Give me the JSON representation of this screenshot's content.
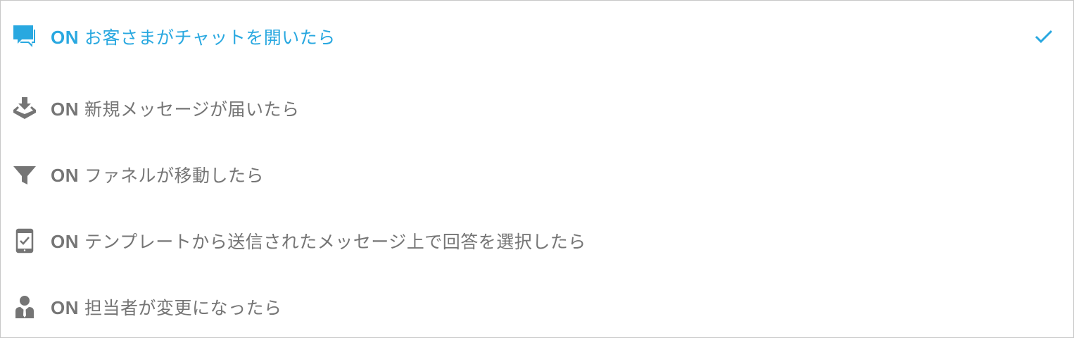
{
  "accent_color": "#29a8e0",
  "text_color": "#757575",
  "triggers": [
    {
      "prefix": "ON",
      "text": "お客さまがチャットを開いたら",
      "icon": "chat-bubbles-icon",
      "selected": true
    },
    {
      "prefix": "ON",
      "text": "新規メッセージが届いたら",
      "icon": "inbox-download-icon",
      "selected": false
    },
    {
      "prefix": "ON",
      "text": "ファネルが移動したら",
      "icon": "funnel-icon",
      "selected": false
    },
    {
      "prefix": "ON",
      "text": "テンプレートから送信されたメッセージ上で回答を選択したら",
      "icon": "mobile-check-icon",
      "selected": false
    },
    {
      "prefix": "ON",
      "text": "担当者が変更になったら",
      "icon": "person-suit-icon",
      "selected": false
    }
  ],
  "selected_indicator": "checkmark-icon"
}
